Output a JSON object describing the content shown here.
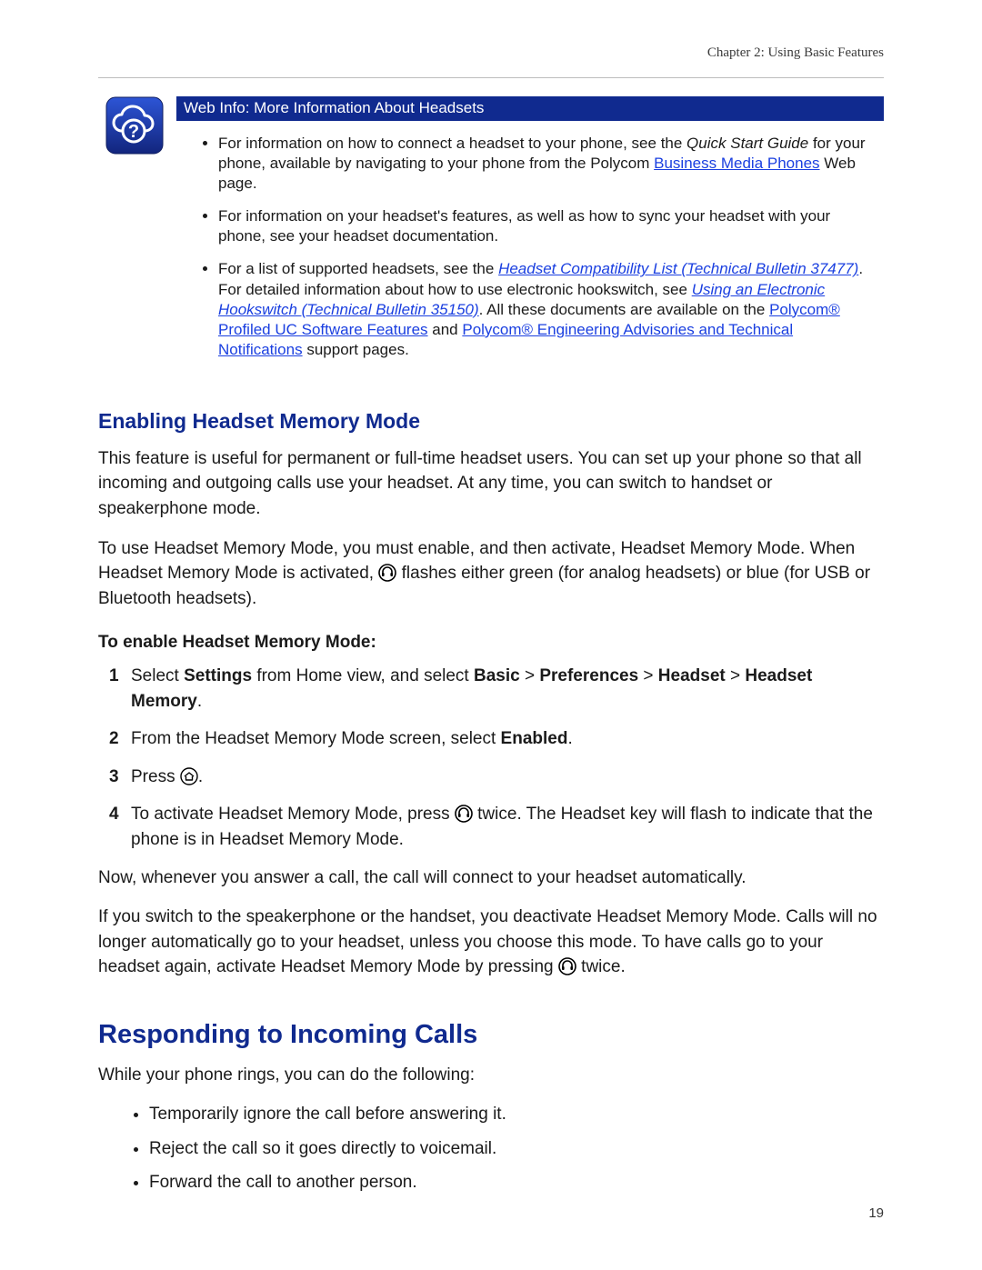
{
  "header": {
    "running": "Chapter 2: Using Basic Features"
  },
  "callout": {
    "title": "Web Info: More Information About Headsets",
    "items": {
      "i1a": "For information on how to connect a headset to your phone, see the ",
      "i1b": "Quick Start Guide",
      "i1c": " for your phone, available by navigating to your phone from the Polycom ",
      "i1d": "Business Media Phones",
      "i1e": " Web page.",
      "i2": "For information on your headset's features, as well as how to sync your headset with your phone, see your headset documentation.",
      "i3a": "For a list of supported headsets, see the ",
      "i3b": "Headset Compatibility List (Technical Bulletin 37477)",
      "i3c": ". For detailed information about how to use electronic hookswitch, see ",
      "i3d": "Using an Electronic Hookswitch (Technical Bulletin 35150)",
      "i3e": ". All these documents are available on the ",
      "i3f": "Polycom® Profiled UC Software Features",
      "i3g": " and ",
      "i3h": "Polycom® Engineering Advisories and Technical Notifications",
      "i3i": "  support pages."
    }
  },
  "section1": {
    "heading": "Enabling Headset Memory Mode",
    "p1": "This feature is useful for permanent or full-time headset users. You can set up your phone so that all incoming and outgoing calls use your headset. At any time, you can switch to handset or speakerphone mode.",
    "p2a": "To use Headset Memory Mode, you must enable, and then activate, Headset Memory Mode. When Headset Memory Mode is activated, ",
    "p2b": " flashes either green (for analog headsets) or blue (for USB or Bluetooth headsets).",
    "procHead": "To enable Headset Memory Mode:",
    "steps": {
      "s1a": "Select ",
      "s1b": "Settings",
      "s1c": " from Home view, and select ",
      "s1d": "Basic",
      "s1e": " > ",
      "s1f": "Preferences",
      "s1g": " > ",
      "s1h": "Headset",
      "s1i": " > ",
      "s1j": "Headset Memory",
      "s1k": ".",
      "s2a": "From the Headset Memory Mode screen, select ",
      "s2b": "Enabled",
      "s2c": ".",
      "s3a": "Press ",
      "s3b": ".",
      "s4a": "To activate Headset Memory Mode, press ",
      "s4b": " twice. The Headset key will flash to indicate that the phone is in Headset Memory Mode."
    },
    "p3": "Now, whenever you answer a call, the call will connect to your headset automatically.",
    "p4a": "If you switch to the speakerphone or the handset, you deactivate Headset Memory Mode. Calls will no longer automatically go to your headset, unless you choose this mode. To have calls go to your headset again, activate Headset Memory Mode by pressing ",
    "p4b": "  twice."
  },
  "section2": {
    "heading": "Responding to Incoming Calls",
    "intro": "While your phone rings, you can do the following:",
    "bullets": {
      "b1": "Temporarily ignore the call before answering it.",
      "b2": "Reject the call so it goes directly to voicemail.",
      "b3": "Forward the call to another person."
    }
  },
  "pageNumber": "19"
}
